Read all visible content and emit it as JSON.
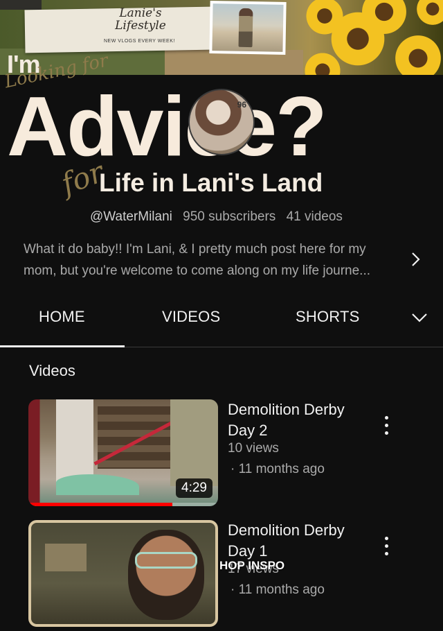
{
  "banner": {
    "logo_text_line1": "Lanie's",
    "logo_text_line2": "Lifestyle",
    "logo_tagline": "NEW VLOGS EVERY WEEK!",
    "im": "I'm",
    "looking_for": "Looking for",
    "advice": "Advice?",
    "avatar_badge": "96",
    "for_script": "for"
  },
  "channel": {
    "title": "Life in Lani's Land",
    "handle": "@WaterMilani",
    "subscribers": "950 subscribers",
    "videos_count": "41 videos",
    "description": "What it do baby!! I'm Lani, & I pretty much post here for my mom, but you're welcome to come along on my life journe..."
  },
  "tabs": [
    {
      "label": "HOME",
      "selected": true
    },
    {
      "label": "VIDEOS",
      "selected": false
    },
    {
      "label": "SHORTS",
      "selected": false
    }
  ],
  "section": {
    "title": "Videos"
  },
  "videos": [
    {
      "title": "Demolition Derby Day 2",
      "views": "10 views",
      "age": "· 11 months ago",
      "duration": "4:29",
      "watched_fraction": 0.76
    },
    {
      "title": "Demolition Derby Day 1",
      "views": "17 views",
      "age": "· 11 months ago",
      "overlay_text": "HOP INSPO"
    }
  ],
  "colors": {
    "background": "#0f0f0f",
    "banner_cream": "#f7ebdc",
    "progress_red": "#ff0000",
    "secondary_text": "#aaaaaa"
  }
}
